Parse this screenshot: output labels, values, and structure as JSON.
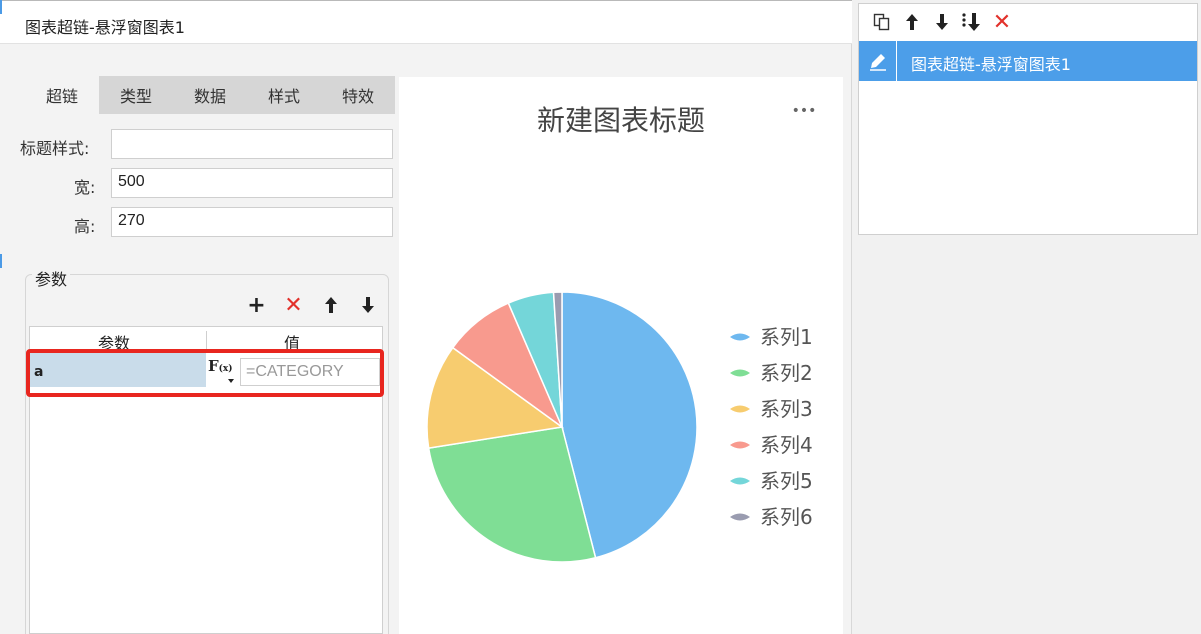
{
  "dialog": {
    "title": "图表超链-悬浮窗图表1",
    "tabs": [
      "超链",
      "类型",
      "数据",
      "样式",
      "特效"
    ],
    "fields": {
      "title_style_label": "标题样式:",
      "title_style_value": "",
      "width_label": "宽:",
      "width_value": "500",
      "height_label": "高:",
      "height_value": "270"
    },
    "params": {
      "group_label": "参数",
      "tools": {
        "add": "+",
        "delete": "✕",
        "up": "🡑",
        "down": "🡓"
      },
      "col_name": "参数",
      "col_value": "值",
      "row": {
        "name": "a",
        "fx_main": "F",
        "fx_sub": "(x)",
        "value_placeholder": "=CATEGORY"
      }
    }
  },
  "chart": {
    "more_label": "•••",
    "colors": [
      "#6eb8ef",
      "#7fde95",
      "#f7cc6f",
      "#f89a8e",
      "#74d6d9",
      "#9a9cb0"
    ]
  },
  "chart_data": {
    "type": "pie",
    "title": "新建图表标题",
    "categories": [
      "系列1",
      "系列2",
      "系列3",
      "系列4",
      "系列5",
      "系列6"
    ],
    "values": [
      46,
      26.5,
      12.5,
      8.5,
      5.5,
      1
    ],
    "legend": "right"
  },
  "right_panel": {
    "tools": {
      "copy": "⧉",
      "up": "🡑",
      "down": "🡓",
      "move_bottom": "⤓",
      "delete": "✕"
    },
    "items": [
      {
        "label": "图表超链-悬浮窗图表1"
      }
    ]
  }
}
